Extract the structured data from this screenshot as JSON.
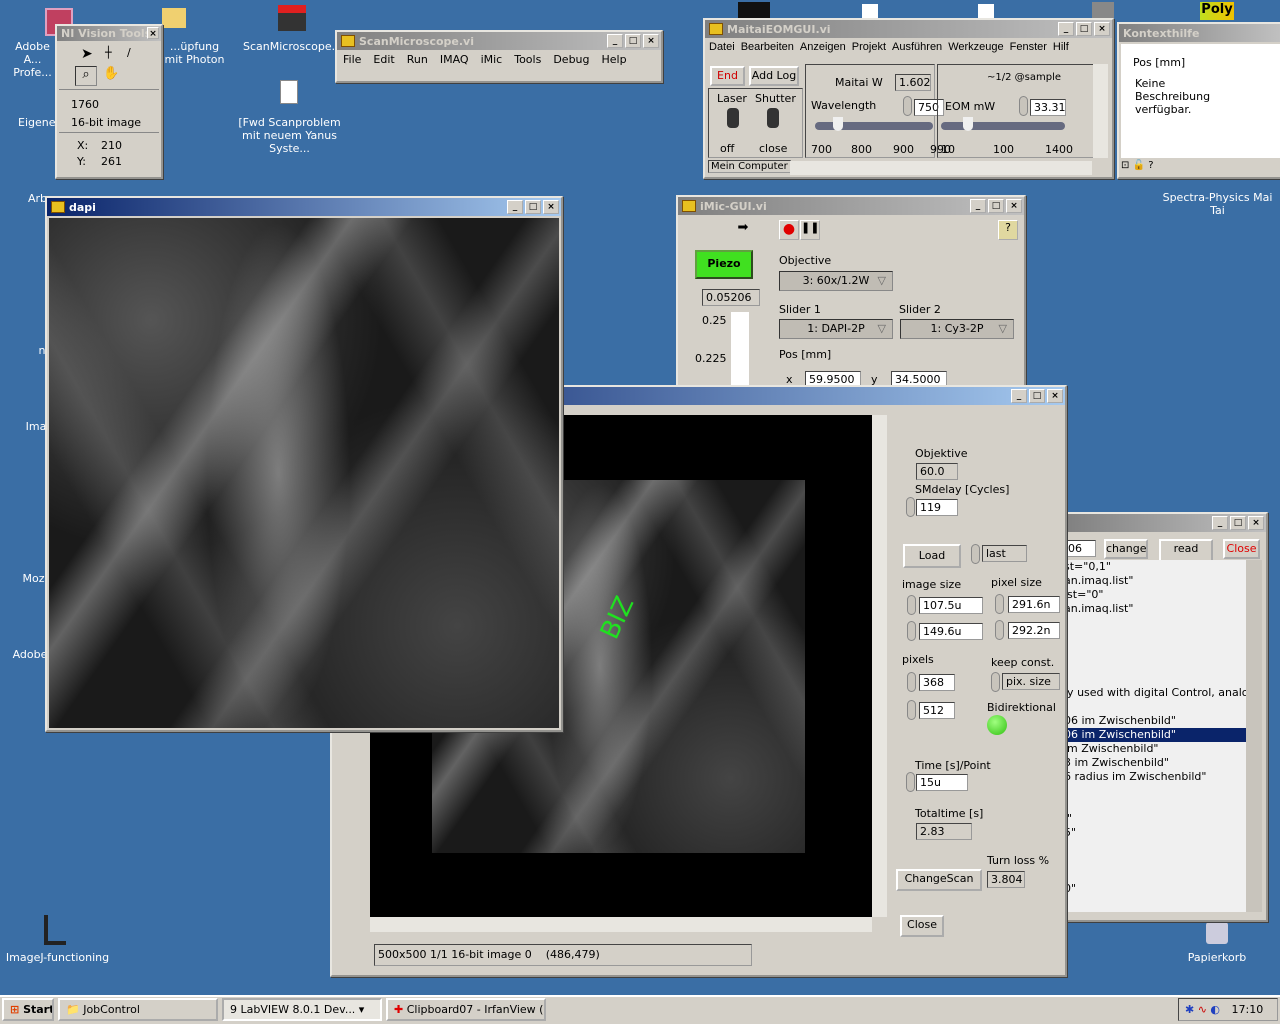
{
  "desktop": {
    "icons": [
      {
        "label": "Adobe A... Profe..."
      },
      {
        "label": "...üpfung mit Photon"
      },
      {
        "label": "ScanMicroscope.vi"
      },
      {
        "label": "[Fwd  Scanproblem mit neuem Yanus Syste..."
      },
      {
        "label": "Eigene..."
      },
      {
        "label": "Arb..."
      },
      {
        "label": "n"
      },
      {
        "label": "Ima"
      },
      {
        "label": "Mozi"
      },
      {
        "label": "Adobe"
      },
      {
        "label": "ImageJ-functioning"
      },
      {
        "label": "Spectra-Physics Mai Tai"
      },
      {
        "label": "Papierkorb"
      },
      {
        "label": "Poly"
      }
    ]
  },
  "vision_tools": {
    "title": "NI Vision Tools",
    "value": "1760",
    "image_type": "16-bit image",
    "x_label": "X:",
    "x": "210",
    "y_label": "Y:",
    "y": "261"
  },
  "scanmicroscope": {
    "title": "ScanMicroscope.vi",
    "menu": [
      "File",
      "Edit",
      "Run",
      "IMAQ",
      "iMic",
      "Tools",
      "Debug",
      "Help"
    ]
  },
  "maitai": {
    "title": "MaitaiEOMGUI.vi",
    "menu": [
      "Datei",
      "Bearbeiten",
      "Anzeigen",
      "Projekt",
      "Ausführen",
      "Werkzeuge",
      "Fenster",
      "Hilf"
    ],
    "end": "End",
    "add_log": "Add Log",
    "laser": "Laser",
    "shutter": "Shutter",
    "off": "off",
    "close": "close",
    "maitai_w_label": "Maitai W",
    "maitai_w": "1.602(",
    "wavelength_label": "Wavelength",
    "wavelength": "750",
    "wl_ticks": [
      "700",
      "800",
      "900",
      "990"
    ],
    "wavelength_min": 700,
    "wavelength_max": 990,
    "sample_label": "~1/2 @sample",
    "eom_label": "EOM mW",
    "eom": "33.31",
    "eom_ticks": [
      "10",
      "100",
      "1400"
    ],
    "context": "Mein Computer"
  },
  "kontext": {
    "title": "Kontexthilfe",
    "heading": "Pos [mm]",
    "body": "Keine Beschreibung verfügbar."
  },
  "imic": {
    "title": "iMic-GUI.vi",
    "piezo": "Piezo",
    "piezo_value": "0.05206",
    "scale": [
      "0.25",
      "0.225"
    ],
    "objective_label": "Objective",
    "objective": "3: 60x/1.2W",
    "slider1_label": "Slider 1",
    "slider1": "1: DAPI-2P",
    "slider2_label": "Slider 2",
    "slider2": "1: Cy3-2P",
    "pos_label": "Pos [mm]",
    "x_label": "x",
    "x": "59.9500",
    "y_label": "y",
    "y": "34.5000",
    "accent": "#40e020"
  },
  "dapi": {
    "title": "dapi"
  },
  "scan": {
    "status": "500x500 1/1 16-bit image 0    (486,479)",
    "overlay_text": "BIZ",
    "objektive_label": "Objektive",
    "objektive": "60.0",
    "smdelay_label": "SMdelay [Cycles]",
    "smdelay": "119",
    "load": "Load",
    "last": "last",
    "image_size_label": "image size",
    "image_w": "107.5u",
    "image_h": "149.6u",
    "pixel_size_label": "pixel size",
    "pixel_w": "291.6n",
    "pixel_h": "292.2n",
    "pixels_label": "pixels",
    "pixels_x": "368",
    "pixels_y": "512",
    "keep_label": "keep const.",
    "keep": "pix. size",
    "bidir_label": "Bidirektional",
    "time_label": "Time [s]/Point",
    "time": "15u",
    "total_label": "Totaltime [s]",
    "total": "2.83",
    "turn_label": "Turn loss %",
    "turn": "3.804",
    "changescan": "ChangeScan",
    "close": "Close"
  },
  "jobtext": {
    "field": "06",
    "change": "change",
    "read_new": "read new",
    "close": "Close",
    "lines": [
      "st=\"0,1\"",
      "an.imaq.list\"",
      "ist=\"0\"",
      "an.imaq.list\"",
      "",
      "",
      "",
      "",
      "",
      "ly used with digital Control, analog-c",
      "",
      "06 im Zwischenbild\"",
      "06 im Zwischenbild\"",
      "im Zwischenbild\"",
      "3 im Zwischenbild\"",
      "6 radius im Zwischenbild\"",
      "",
      "",
      "l\"",
      "5\"",
      "",
      "",
      "",
      "0\""
    ],
    "selected": 12
  },
  "taskbar": {
    "start": "Start",
    "items": [
      "JobControl",
      "9 LabVIEW 8.0.1 Dev...",
      "Clipboard07 - IrfanView (..."
    ],
    "clock": "17:10"
  }
}
